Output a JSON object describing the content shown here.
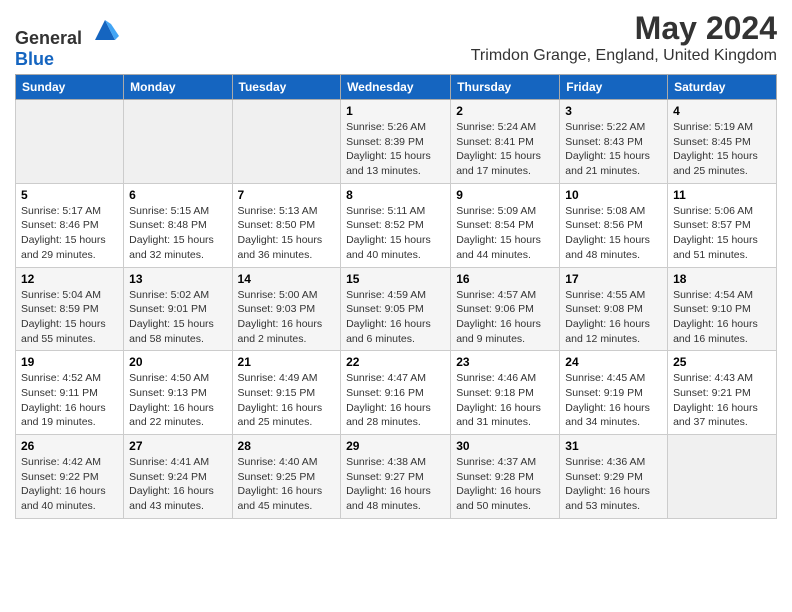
{
  "header": {
    "logo_general": "General",
    "logo_blue": "Blue",
    "title": "May 2024",
    "subtitle": "Trimdon Grange, England, United Kingdom"
  },
  "calendar": {
    "days_of_week": [
      "Sunday",
      "Monday",
      "Tuesday",
      "Wednesday",
      "Thursday",
      "Friday",
      "Saturday"
    ],
    "weeks": [
      [
        {
          "day": "",
          "info": ""
        },
        {
          "day": "",
          "info": ""
        },
        {
          "day": "",
          "info": ""
        },
        {
          "day": "1",
          "info": "Sunrise: 5:26 AM\nSunset: 8:39 PM\nDaylight: 15 hours\nand 13 minutes."
        },
        {
          "day": "2",
          "info": "Sunrise: 5:24 AM\nSunset: 8:41 PM\nDaylight: 15 hours\nand 17 minutes."
        },
        {
          "day": "3",
          "info": "Sunrise: 5:22 AM\nSunset: 8:43 PM\nDaylight: 15 hours\nand 21 minutes."
        },
        {
          "day": "4",
          "info": "Sunrise: 5:19 AM\nSunset: 8:45 PM\nDaylight: 15 hours\nand 25 minutes."
        }
      ],
      [
        {
          "day": "5",
          "info": "Sunrise: 5:17 AM\nSunset: 8:46 PM\nDaylight: 15 hours\nand 29 minutes."
        },
        {
          "day": "6",
          "info": "Sunrise: 5:15 AM\nSunset: 8:48 PM\nDaylight: 15 hours\nand 32 minutes."
        },
        {
          "day": "7",
          "info": "Sunrise: 5:13 AM\nSunset: 8:50 PM\nDaylight: 15 hours\nand 36 minutes."
        },
        {
          "day": "8",
          "info": "Sunrise: 5:11 AM\nSunset: 8:52 PM\nDaylight: 15 hours\nand 40 minutes."
        },
        {
          "day": "9",
          "info": "Sunrise: 5:09 AM\nSunset: 8:54 PM\nDaylight: 15 hours\nand 44 minutes."
        },
        {
          "day": "10",
          "info": "Sunrise: 5:08 AM\nSunset: 8:56 PM\nDaylight: 15 hours\nand 48 minutes."
        },
        {
          "day": "11",
          "info": "Sunrise: 5:06 AM\nSunset: 8:57 PM\nDaylight: 15 hours\nand 51 minutes."
        }
      ],
      [
        {
          "day": "12",
          "info": "Sunrise: 5:04 AM\nSunset: 8:59 PM\nDaylight: 15 hours\nand 55 minutes."
        },
        {
          "day": "13",
          "info": "Sunrise: 5:02 AM\nSunset: 9:01 PM\nDaylight: 15 hours\nand 58 minutes."
        },
        {
          "day": "14",
          "info": "Sunrise: 5:00 AM\nSunset: 9:03 PM\nDaylight: 16 hours\nand 2 minutes."
        },
        {
          "day": "15",
          "info": "Sunrise: 4:59 AM\nSunset: 9:05 PM\nDaylight: 16 hours\nand 6 minutes."
        },
        {
          "day": "16",
          "info": "Sunrise: 4:57 AM\nSunset: 9:06 PM\nDaylight: 16 hours\nand 9 minutes."
        },
        {
          "day": "17",
          "info": "Sunrise: 4:55 AM\nSunset: 9:08 PM\nDaylight: 16 hours\nand 12 minutes."
        },
        {
          "day": "18",
          "info": "Sunrise: 4:54 AM\nSunset: 9:10 PM\nDaylight: 16 hours\nand 16 minutes."
        }
      ],
      [
        {
          "day": "19",
          "info": "Sunrise: 4:52 AM\nSunset: 9:11 PM\nDaylight: 16 hours\nand 19 minutes."
        },
        {
          "day": "20",
          "info": "Sunrise: 4:50 AM\nSunset: 9:13 PM\nDaylight: 16 hours\nand 22 minutes."
        },
        {
          "day": "21",
          "info": "Sunrise: 4:49 AM\nSunset: 9:15 PM\nDaylight: 16 hours\nand 25 minutes."
        },
        {
          "day": "22",
          "info": "Sunrise: 4:47 AM\nSunset: 9:16 PM\nDaylight: 16 hours\nand 28 minutes."
        },
        {
          "day": "23",
          "info": "Sunrise: 4:46 AM\nSunset: 9:18 PM\nDaylight: 16 hours\nand 31 minutes."
        },
        {
          "day": "24",
          "info": "Sunrise: 4:45 AM\nSunset: 9:19 PM\nDaylight: 16 hours\nand 34 minutes."
        },
        {
          "day": "25",
          "info": "Sunrise: 4:43 AM\nSunset: 9:21 PM\nDaylight: 16 hours\nand 37 minutes."
        }
      ],
      [
        {
          "day": "26",
          "info": "Sunrise: 4:42 AM\nSunset: 9:22 PM\nDaylight: 16 hours\nand 40 minutes."
        },
        {
          "day": "27",
          "info": "Sunrise: 4:41 AM\nSunset: 9:24 PM\nDaylight: 16 hours\nand 43 minutes."
        },
        {
          "day": "28",
          "info": "Sunrise: 4:40 AM\nSunset: 9:25 PM\nDaylight: 16 hours\nand 45 minutes."
        },
        {
          "day": "29",
          "info": "Sunrise: 4:38 AM\nSunset: 9:27 PM\nDaylight: 16 hours\nand 48 minutes."
        },
        {
          "day": "30",
          "info": "Sunrise: 4:37 AM\nSunset: 9:28 PM\nDaylight: 16 hours\nand 50 minutes."
        },
        {
          "day": "31",
          "info": "Sunrise: 4:36 AM\nSunset: 9:29 PM\nDaylight: 16 hours\nand 53 minutes."
        },
        {
          "day": "",
          "info": ""
        }
      ]
    ]
  }
}
